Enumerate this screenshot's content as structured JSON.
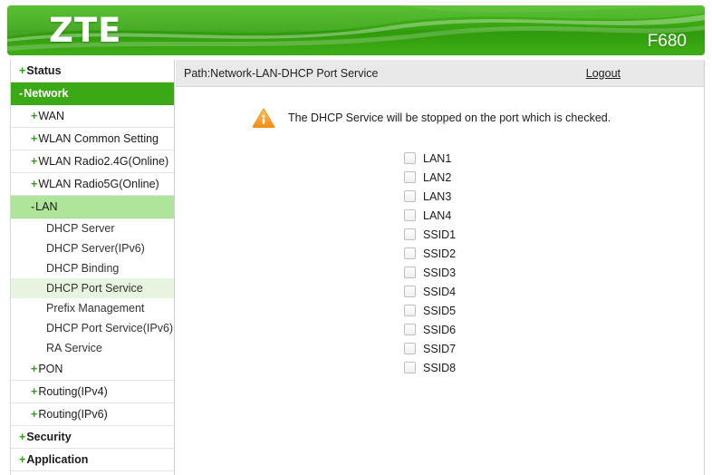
{
  "banner": {
    "brand": "ZTE",
    "model": "F680",
    "brand_color": "#3ba916"
  },
  "sidebar": {
    "items": [
      {
        "sign": "+",
        "label": "Status",
        "level": 0,
        "state": "normal"
      },
      {
        "sign": "-",
        "label": "Network",
        "level": 0,
        "state": "active-dark"
      },
      {
        "sign": "+",
        "label": "WAN",
        "level": 1,
        "state": "normal"
      },
      {
        "sign": "+",
        "label": "WLAN Common Setting",
        "level": 1,
        "state": "normal"
      },
      {
        "sign": "+",
        "label": "WLAN Radio2.4G(Online)",
        "level": 1,
        "state": "normal"
      },
      {
        "sign": "+",
        "label": "WLAN Radio5G(Online)",
        "level": 1,
        "state": "normal"
      },
      {
        "sign": "-",
        "label": "LAN",
        "level": 1,
        "state": "active-light"
      },
      {
        "sign": "",
        "label": "DHCP Server",
        "level": 2,
        "state": "normal"
      },
      {
        "sign": "",
        "label": "DHCP Server(IPv6)",
        "level": 2,
        "state": "normal"
      },
      {
        "sign": "",
        "label": "DHCP Binding",
        "level": 2,
        "state": "normal"
      },
      {
        "sign": "",
        "label": "DHCP Port Service",
        "level": 2,
        "state": "selected-leaf"
      },
      {
        "sign": "",
        "label": "Prefix Management",
        "level": 2,
        "state": "normal"
      },
      {
        "sign": "",
        "label": "DHCP Port Service(IPv6)",
        "level": 2,
        "state": "normal"
      },
      {
        "sign": "",
        "label": "RA Service",
        "level": 2,
        "state": "normal"
      },
      {
        "sign": "+",
        "label": "PON",
        "level": 1,
        "state": "normal"
      },
      {
        "sign": "+",
        "label": "Routing(IPv4)",
        "level": 1,
        "state": "normal"
      },
      {
        "sign": "+",
        "label": "Routing(IPv6)",
        "level": 1,
        "state": "normal"
      },
      {
        "sign": "+",
        "label": "Security",
        "level": 0,
        "state": "normal"
      },
      {
        "sign": "+",
        "label": "Application",
        "level": 0,
        "state": "normal"
      }
    ]
  },
  "content": {
    "path": "Path:Network-LAN-DHCP Port Service",
    "logout_label": "Logout",
    "warning": {
      "icon": "warning-triangle-icon",
      "message": "The DHCP Service will be stopped on the port which is checked.",
      "color": "#f5a623"
    },
    "ports": [
      {
        "label": "LAN1",
        "checked": false
      },
      {
        "label": "LAN2",
        "checked": false
      },
      {
        "label": "LAN3",
        "checked": false
      },
      {
        "label": "LAN4",
        "checked": false
      },
      {
        "label": "SSID1",
        "checked": false
      },
      {
        "label": "SSID2",
        "checked": false
      },
      {
        "label": "SSID3",
        "checked": false
      },
      {
        "label": "SSID4",
        "checked": false
      },
      {
        "label": "SSID5",
        "checked": false
      },
      {
        "label": "SSID6",
        "checked": false
      },
      {
        "label": "SSID7",
        "checked": false
      },
      {
        "label": "SSID8",
        "checked": false
      }
    ]
  }
}
